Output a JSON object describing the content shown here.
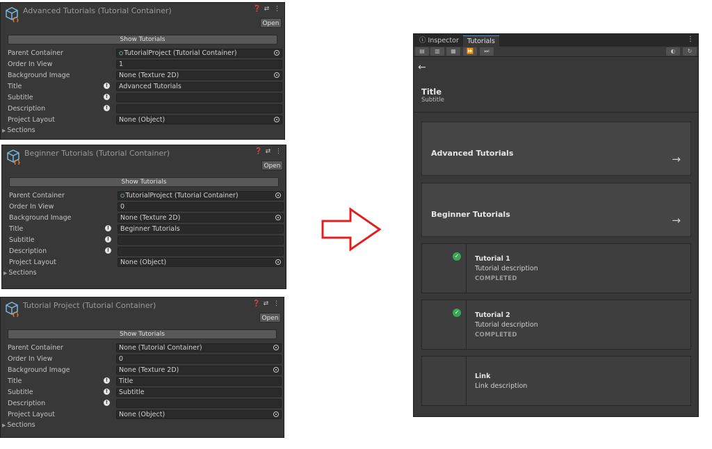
{
  "panels": [
    {
      "title": "Advanced Tutorials (Tutorial Container)",
      "open_label": "Open",
      "show_label": "Show Tutorials",
      "rows": [
        {
          "label": "Parent Container",
          "value": "TutorialProject (Tutorial Container)"
        },
        {
          "label": "Order In View",
          "value": "1"
        },
        {
          "label": "Background Image",
          "value": "None (Texture 2D)"
        },
        {
          "label": "Title",
          "value": "Advanced Tutorials"
        },
        {
          "label": "Subtitle",
          "value": ""
        },
        {
          "label": "Description",
          "value": ""
        },
        {
          "label": "Project Layout",
          "value": "None (Object)"
        }
      ],
      "sections_label": "Sections"
    },
    {
      "title": "Beginner Tutorials (Tutorial Container)",
      "open_label": "Open",
      "show_label": "Show Tutorials",
      "rows": [
        {
          "label": "Parent Container",
          "value": "TutorialProject (Tutorial Container)"
        },
        {
          "label": "Order In View",
          "value": "0"
        },
        {
          "label": "Background Image",
          "value": "None (Texture 2D)"
        },
        {
          "label": "Title",
          "value": "Beginner Tutorials"
        },
        {
          "label": "Subtitle",
          "value": ""
        },
        {
          "label": "Description",
          "value": ""
        },
        {
          "label": "Project Layout",
          "value": "None (Object)"
        }
      ],
      "sections_label": "Sections"
    },
    {
      "title": "Tutorial Project (Tutorial Container)",
      "open_label": "Open",
      "show_label": "Show Tutorials",
      "rows": [
        {
          "label": "Parent Container",
          "value": "None (Tutorial Container)"
        },
        {
          "label": "Order In View",
          "value": "0"
        },
        {
          "label": "Background Image",
          "value": "None (Texture 2D)"
        },
        {
          "label": "Title",
          "value": "Title"
        },
        {
          "label": "Subtitle",
          "value": "Subtitle"
        },
        {
          "label": "Description",
          "value": ""
        },
        {
          "label": "Project Layout",
          "value": "None (Object)"
        }
      ],
      "sections_label": "Sections"
    }
  ],
  "window": {
    "tab_inspector": "Inspector",
    "tab_tutorials": "Tutorials",
    "title": "Title",
    "subtitle": "Subtitle",
    "cards": [
      {
        "title": "Advanced Tutorials"
      },
      {
        "title": "Beginner Tutorials"
      }
    ],
    "tutorials": [
      {
        "title": "Tutorial 1",
        "description": "Tutorial description",
        "status": "COMPLETED"
      },
      {
        "title": "Tutorial 2",
        "description": "Tutorial description",
        "status": "COMPLETED"
      },
      {
        "title": "Link",
        "description": "Link description",
        "status": ""
      }
    ]
  },
  "colors": {
    "panel_bg": "#383838",
    "field_bg": "#2a2a2a",
    "accent_red": "#e02020",
    "check_green": "#3aa757"
  },
  "icons": [
    "tutorial-container-icon",
    "help-icon",
    "settings-icon",
    "more-icon",
    "object-picker-icon",
    "warning-icon",
    "back-arrow-icon",
    "forward-arrow-icon",
    "check-icon",
    "refresh-icon"
  ]
}
